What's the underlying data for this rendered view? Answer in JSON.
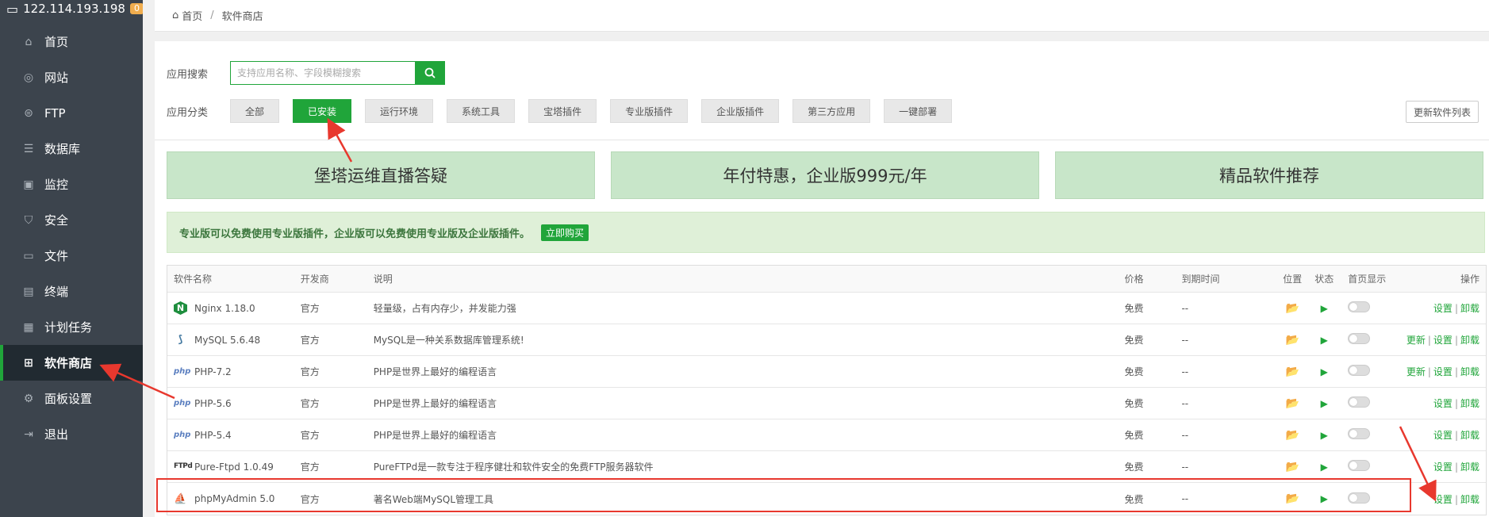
{
  "sidebar": {
    "server_ip": "122.114.193.198",
    "badge": "0",
    "items": [
      {
        "label": "首页",
        "icon": "home-icon"
      },
      {
        "label": "网站",
        "icon": "globe-icon"
      },
      {
        "label": "FTP",
        "icon": "ftp-icon"
      },
      {
        "label": "数据库",
        "icon": "database-icon"
      },
      {
        "label": "监控",
        "icon": "monitor-icon"
      },
      {
        "label": "安全",
        "icon": "shield-icon"
      },
      {
        "label": "文件",
        "icon": "folder-icon"
      },
      {
        "label": "终端",
        "icon": "terminal-icon"
      },
      {
        "label": "计划任务",
        "icon": "calendar-icon"
      },
      {
        "label": "软件商店",
        "icon": "grid-icon",
        "active": true
      },
      {
        "label": "面板设置",
        "icon": "gear-icon"
      },
      {
        "label": "退出",
        "icon": "logout-icon"
      }
    ]
  },
  "breadcrumb": {
    "home": "首页",
    "current": "软件商店"
  },
  "search": {
    "label": "应用搜索",
    "placeholder": "支持应用名称、字段模糊搜索"
  },
  "categories": {
    "label": "应用分类",
    "items": [
      "全部",
      "已安装",
      "运行环境",
      "系统工具",
      "宝塔插件",
      "专业版插件",
      "企业版插件",
      "第三方应用",
      "一键部署"
    ],
    "active": "已安装"
  },
  "refresh_label": "更新软件列表",
  "promos": [
    "堡塔运维直播答疑",
    "年付特惠，企业版999元/年",
    "精品软件推荐"
  ],
  "notice": {
    "text": "专业版可以免费使用专业版插件，企业版可以免费使用专业版及企业版插件。",
    "button": "立即购买"
  },
  "table": {
    "headers": {
      "name": "软件名称",
      "dev": "开发商",
      "desc": "说明",
      "price": "价格",
      "expire": "到期时间",
      "location": "位置",
      "status": "状态",
      "home": "首页显示",
      "ops": "操作"
    },
    "rows": [
      {
        "icon": "nginx-icon",
        "glyph": "N",
        "name": "Nginx 1.18.0",
        "dev": "官方",
        "desc": "轻量级，占有内存少，并发能力强",
        "price": "免费",
        "expire": "--",
        "ops": [
          "设置",
          "卸载"
        ]
      },
      {
        "icon": "mysql-icon",
        "glyph": "⟆",
        "name": "MySQL 5.6.48",
        "dev": "官方",
        "desc": "MySQL是一种关系数据库管理系统!",
        "price": "免费",
        "expire": "--",
        "ops": [
          "更新",
          "设置",
          "卸载"
        ]
      },
      {
        "icon": "php-icon",
        "glyph": "php",
        "name": "PHP-7.2",
        "dev": "官方",
        "desc": "PHP是世界上最好的编程语言",
        "price": "免费",
        "expire": "--",
        "ops": [
          "更新",
          "设置",
          "卸载"
        ]
      },
      {
        "icon": "php-icon",
        "glyph": "php",
        "name": "PHP-5.6",
        "dev": "官方",
        "desc": "PHP是世界上最好的编程语言",
        "price": "免费",
        "expire": "--",
        "ops": [
          "设置",
          "卸载"
        ]
      },
      {
        "icon": "php-icon",
        "glyph": "php",
        "name": "PHP-5.4",
        "dev": "官方",
        "desc": "PHP是世界上最好的编程语言",
        "price": "免费",
        "expire": "--",
        "ops": [
          "设置",
          "卸载"
        ]
      },
      {
        "icon": "ftp-icon",
        "glyph": "FTPd",
        "name": "Pure-Ftpd 1.0.49",
        "dev": "官方",
        "desc": "PureFTPd是一款专注于程序健壮和软件安全的免费FTP服务器软件",
        "price": "免费",
        "expire": "--",
        "ops": [
          "设置",
          "卸载"
        ]
      },
      {
        "icon": "phpmyadmin-icon",
        "glyph": "⛵",
        "name": "phpMyAdmin 5.0",
        "dev": "官方",
        "desc": "著名Web端MySQL管理工具",
        "price": "免费",
        "expire": "--",
        "ops": [
          "设置",
          "卸载"
        ]
      }
    ]
  },
  "colors": {
    "accent": "#20a53a",
    "sidebar": "#3c444d",
    "annotation": "#e8382e"
  }
}
